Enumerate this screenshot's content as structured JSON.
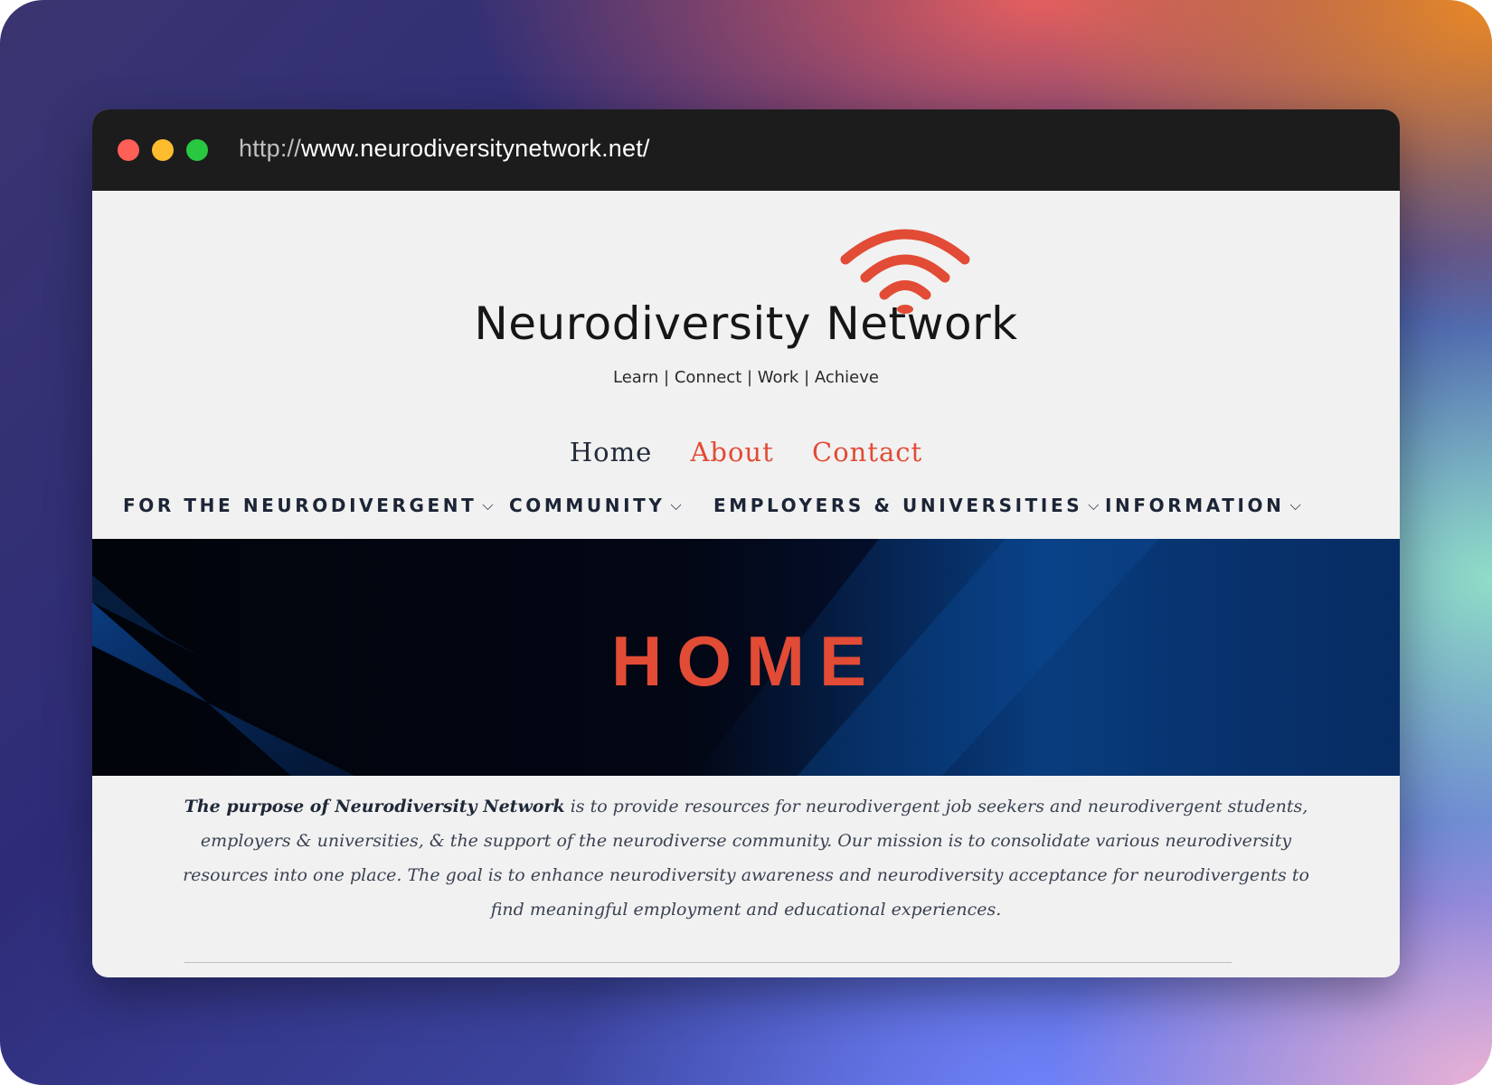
{
  "browser": {
    "url_protocol": "http://",
    "url_rest": "www.neurodiversitynetwork.net/",
    "controls": [
      "close",
      "minimize",
      "maximize"
    ]
  },
  "header": {
    "brand_name": "Neurodiversity Network",
    "tagline": "Learn | Connect | Work | Achieve",
    "logo_icon": "wifi-signal-icon"
  },
  "top_nav": {
    "home": "Home",
    "about": "About",
    "contact": "Contact"
  },
  "category_nav": [
    {
      "label": "FOR THE NEURODIVERGENT",
      "icon": "chevron-down-icon"
    },
    {
      "label": "COMMUNITY",
      "icon": "chevron-down-icon"
    },
    {
      "label": "EMPLOYERS & UNIVERSITIES",
      "icon": "chevron-down-icon"
    },
    {
      "label": "INFORMATION",
      "icon": "chevron-down-icon"
    }
  ],
  "hero": {
    "title": "HOME"
  },
  "intro": {
    "lead": "The purpose of Neurodiversity Network",
    "body": " is to provide resources for neurodivergent job seekers and neurodivergent students, employers & universities, & the support of the neurodiverse community.  Our mission is to consolidate various neurodiversity resources into one place. The goal is to enhance neurodiversity awareness and neurodiversity acceptance for neurodivergents to find meaningful employment and educational experiences."
  },
  "colors": {
    "accent": "#e24b35",
    "nav_text": "#1c2536",
    "page_bg": "#f1f1f1",
    "titlebar": "#1c1c1c",
    "close": "#ff5f57",
    "minimize": "#febc2e",
    "maximize": "#28c840"
  }
}
